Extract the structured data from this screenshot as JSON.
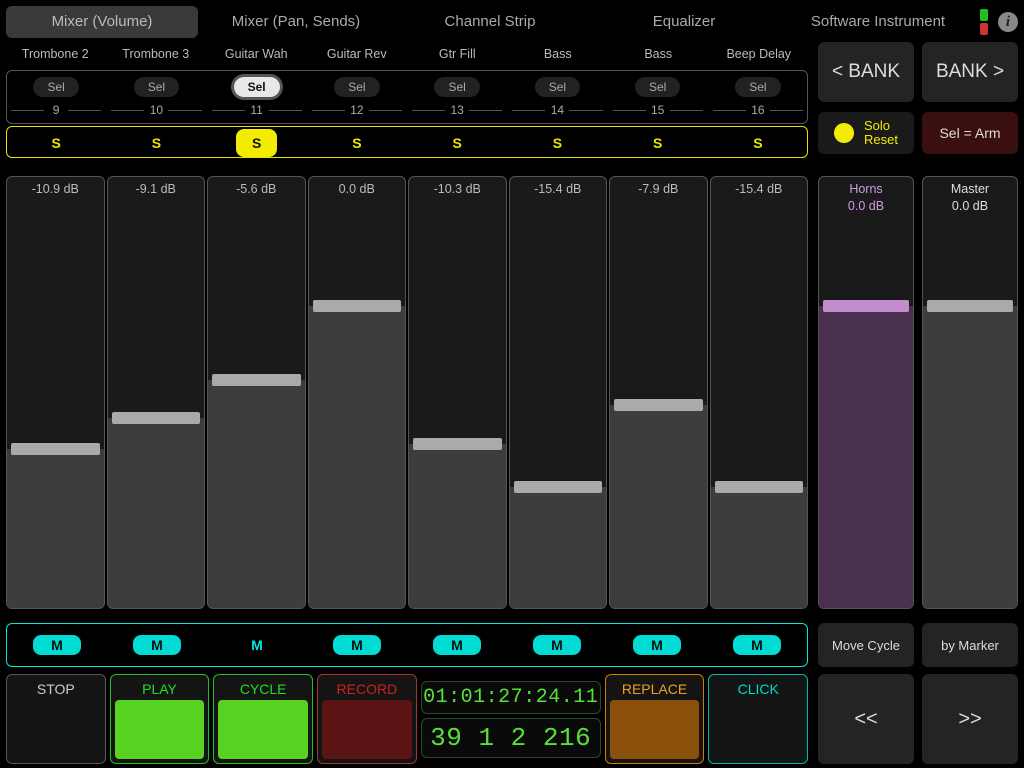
{
  "tabs": [
    "Mixer (Volume)",
    "Mixer (Pan, Sends)",
    "Channel Strip",
    "Equalizer",
    "Software Instrument"
  ],
  "active_tab": 0,
  "sel_label": "Sel",
  "solo_label": "S",
  "mute_label": "M",
  "tracks": [
    {
      "name": "Trombone 2",
      "num": "9",
      "db": "-10.9 dB",
      "level": 0.37,
      "sel": false,
      "solo": false,
      "mute": true
    },
    {
      "name": "Trombone 3",
      "num": "10",
      "db": "-9.1 dB",
      "level": 0.44,
      "sel": false,
      "solo": false,
      "mute": true
    },
    {
      "name": "Guitar Wah",
      "num": "11",
      "db": "-5.6 dB",
      "level": 0.53,
      "sel": true,
      "solo": true,
      "mute": false
    },
    {
      "name": "Guitar Rev",
      "num": "12",
      "db": "0.0 dB",
      "level": 0.7,
      "sel": false,
      "solo": false,
      "mute": true
    },
    {
      "name": "Gtr Fill",
      "num": "13",
      "db": "-10.3 dB",
      "level": 0.38,
      "sel": false,
      "solo": false,
      "mute": true
    },
    {
      "name": "Bass",
      "num": "14",
      "db": "-15.4 dB",
      "level": 0.28,
      "sel": false,
      "solo": false,
      "mute": true
    },
    {
      "name": "Bass",
      "num": "15",
      "db": "-7.9 dB",
      "level": 0.47,
      "sel": false,
      "solo": false,
      "mute": true
    },
    {
      "name": "Beep Delay",
      "num": "16",
      "db": "-15.4 dB",
      "level": 0.28,
      "sel": false,
      "solo": false,
      "mute": true
    }
  ],
  "bank_prev": "< BANK",
  "bank_next": "BANK >",
  "solo_reset": "Solo\nReset",
  "sel_arm": "Sel = Arm",
  "groups": {
    "horns": {
      "name": "Horns",
      "db": "0.0 dB",
      "level": 0.7
    },
    "master": {
      "name": "Master",
      "db": "0.0 dB",
      "level": 0.7
    }
  },
  "move_cycle": "Move Cycle",
  "by_marker": "by Marker",
  "transport": {
    "stop": "STOP",
    "play": "PLAY",
    "cycle": "CYCLE",
    "record": "RECORD",
    "replace": "REPLACE",
    "click": "CLICK",
    "time": "01:01:27:24.11",
    "bbp": "39  1  2 216",
    "prev": "<<",
    "next": ">>"
  }
}
